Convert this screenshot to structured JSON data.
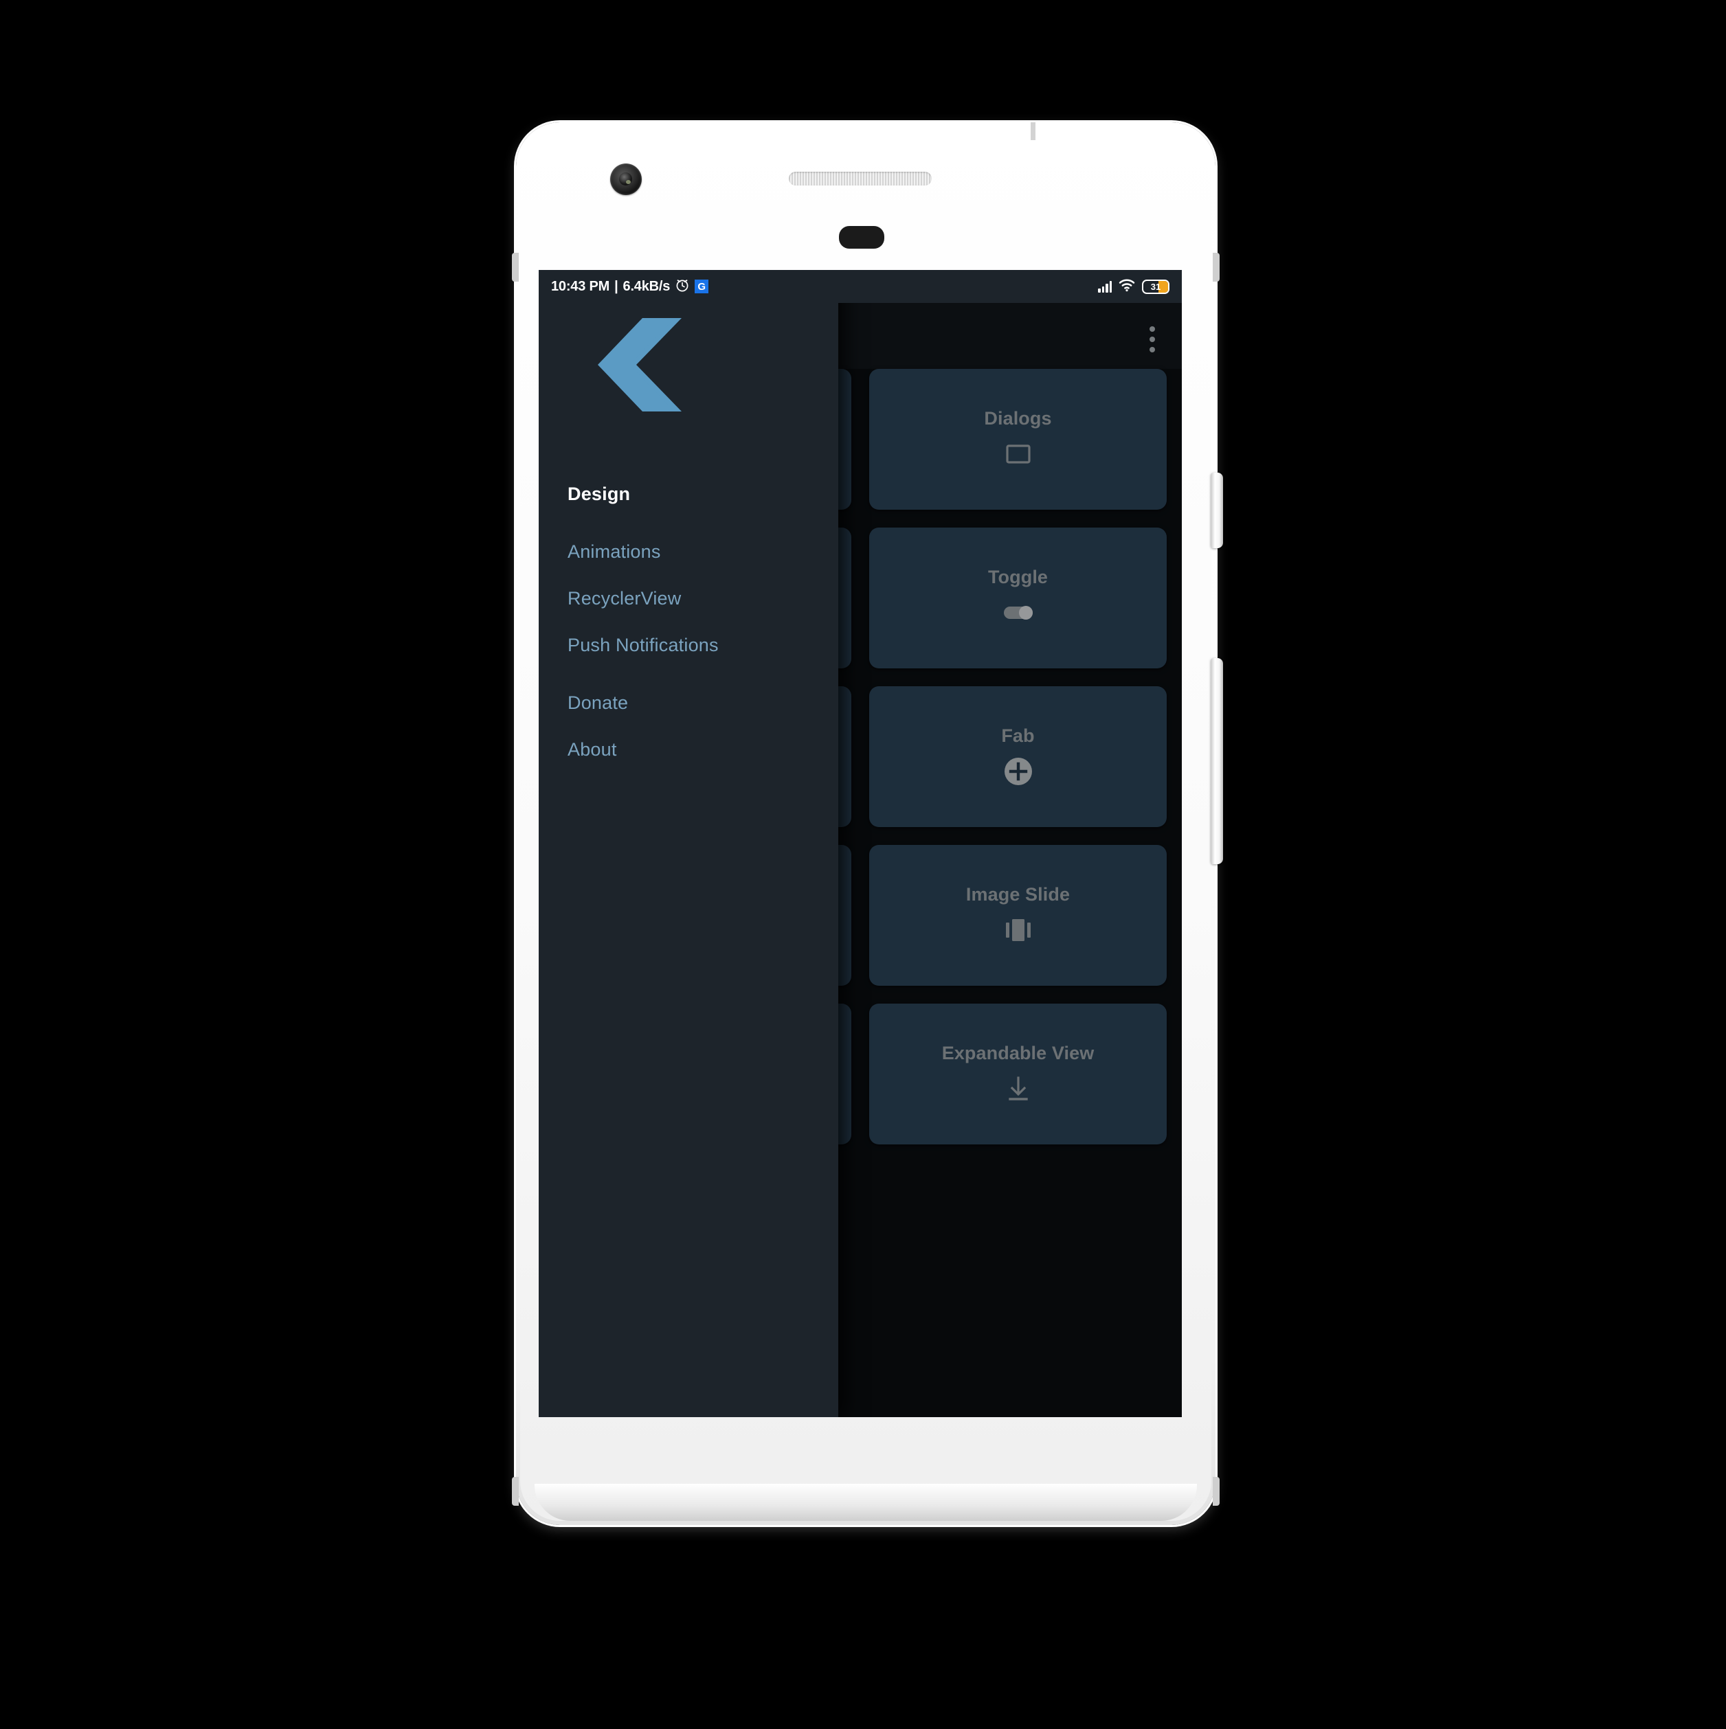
{
  "device": {
    "frame_color": "#ffffff",
    "hardware": {
      "front_camera": "front-camera",
      "earpiece": "earpiece-speaker",
      "proximity_sensor": "proximity-sensor",
      "power_button": "power-button",
      "volume_button": "volume-rocker"
    }
  },
  "status_bar": {
    "time": "10:43 PM",
    "separator": "|",
    "network_speed": "6.4kB/s",
    "alarm_icon": "alarm-clock-icon",
    "app_badge_glyph": "G",
    "app_badge_color": "#1a73e8",
    "signal_icon": "cellular-signal-icon",
    "wifi_icon": "wifi-icon",
    "battery_level": "31",
    "battery_color": "#f0a41e",
    "background": "#1d242b"
  },
  "toolbar": {
    "overflow_menu_label": "overflow-menu",
    "background": "#12161a"
  },
  "drawer": {
    "background": "#1d242b",
    "logo": {
      "name": "double-chevron-left-logo",
      "color": "#5b9bc4"
    },
    "active_color": "#ffffff",
    "item_color": "#7ba3bf",
    "items": [
      {
        "label": "Design",
        "active": true
      },
      {
        "label": "Animations",
        "active": false
      },
      {
        "label": "RecyclerView",
        "active": false
      },
      {
        "label": "Push Notifications",
        "active": false
      },
      {
        "label": "Donate",
        "active": false
      },
      {
        "label": "About",
        "active": false
      }
    ]
  },
  "content": {
    "background": "#0b0e11",
    "card_background": "#2a4257",
    "card_label_color": "#9ba2a7",
    "cards": [
      {
        "label": "Dialogs",
        "icon": "rectangle-outline-icon"
      },
      {
        "label": "Toggle",
        "icon": "toggle-switch-icon"
      },
      {
        "label": "Fab",
        "icon": "floating-action-button-plus-icon"
      },
      {
        "label": "Image Slide",
        "icon": "view-carousel-icon"
      },
      {
        "label": "Expandable View",
        "icon": "arrow-down-to-line-icon"
      }
    ]
  }
}
